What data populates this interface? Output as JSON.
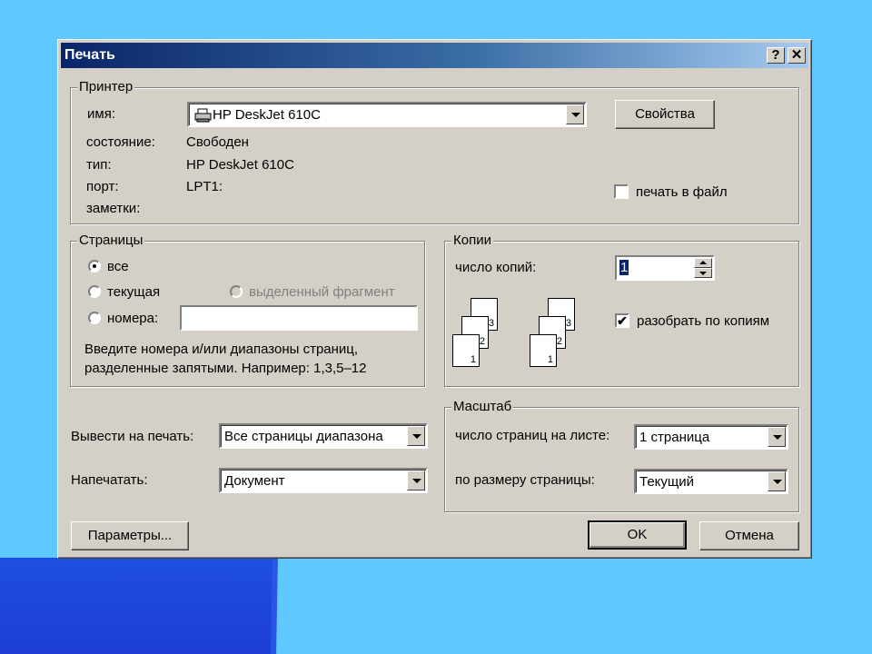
{
  "window": {
    "title": "Печать",
    "help_btn": "?",
    "close_btn": "✕"
  },
  "printer": {
    "legend": "Принтер",
    "name_label": "имя:",
    "name_value": "HP DeskJet 610C",
    "status_label": "состояние:",
    "status_value": "Свободен",
    "type_label": "тип:",
    "type_value": "HP DeskJet 610C",
    "port_label": "порт:",
    "port_value": "LPT1:",
    "notes_label": "заметки:",
    "properties_button": "Свойства",
    "print_to_file": "печать в файл",
    "print_to_file_checked": false
  },
  "pages": {
    "legend": "Страницы",
    "all": "все",
    "current": "текущая",
    "selection": "выделенный фрагмент",
    "numbers": "номера:",
    "numbers_value": "",
    "selected": "all",
    "hint_line1": "Введите номера и/или диапазоны страниц,",
    "hint_line2": "разделенные запятыми. Например: 1,3,5–12"
  },
  "copies": {
    "legend": "Копии",
    "count_label": "число копий:",
    "count_value": "1",
    "collate": "разобрать по копиям",
    "collate_checked": true,
    "collate_mark": "✔",
    "stack_labels": [
      "3",
      "2",
      "1"
    ]
  },
  "print_what": {
    "print_label": "Вывести на печать:",
    "print_value": "Все страницы диапазона",
    "what_label": "Напечатать:",
    "what_value": "Документ"
  },
  "zoom": {
    "legend": "Масштаб",
    "pages_per_sheet_label": "число страниц на листе:",
    "pages_per_sheet_value": "1 страница",
    "scale_label": "по размеру страницы:",
    "scale_value": "Текущий"
  },
  "buttons": {
    "options": "Параметры...",
    "ok": "OK",
    "cancel": "Отмена"
  }
}
